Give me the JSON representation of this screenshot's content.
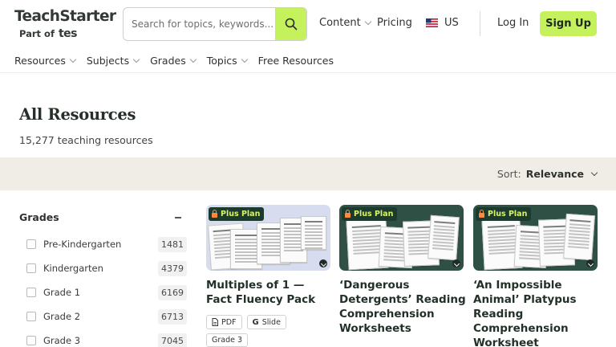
{
  "header": {
    "logo_text": "TeachStarter",
    "logo_sub": "Part of",
    "logo_tes": "tes",
    "search_placeholder": "Search for topics, keywords...",
    "nav_content": "Content",
    "nav_pricing": "Pricing",
    "nav_region": "US",
    "login": "Log In",
    "signup": "Sign Up",
    "accent_color": "#c4f15c"
  },
  "subnav": {
    "resources": "Resources",
    "subjects": "Subjects",
    "grades": "Grades",
    "topics": "Topics",
    "free_resources": "Free Resources"
  },
  "page": {
    "title": "All Resources",
    "count": "15,277 teaching resources"
  },
  "sort": {
    "label": "Sort:",
    "value": "Relevance"
  },
  "filter": {
    "title": "Grades",
    "items": [
      {
        "label": "Pre-Kindergarten",
        "count": "1481"
      },
      {
        "label": "Kindergarten",
        "count": "4379"
      },
      {
        "label": "Grade 1",
        "count": "6169"
      },
      {
        "label": "Grade 2",
        "count": "6713"
      },
      {
        "label": "Grade 3",
        "count": "7045"
      }
    ]
  },
  "cards": [
    {
      "badge": "Plus Plan",
      "title": "Multiples of 1 — Fact Fluency Pack",
      "tag_pdf": "PDF",
      "tag_slide": "Slide",
      "grade": "Grade 3"
    },
    {
      "badge": "Plus Plan",
      "title": "‘Dangerous Detergents’ Reading Comprehension Worksheets"
    },
    {
      "badge": "Plus Plan",
      "title": "‘An Impossible Animal’ Platypus Reading Comprehension Worksheet"
    }
  ]
}
